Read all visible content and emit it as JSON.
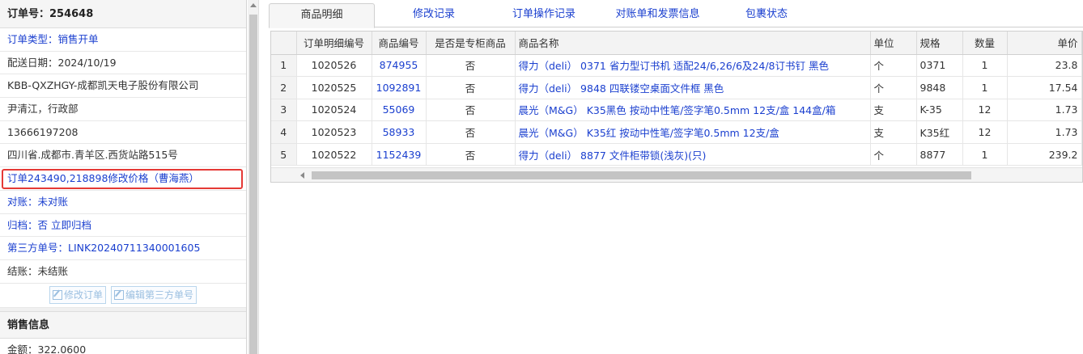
{
  "order": {
    "header": "订单号：254648",
    "rows": [
      {
        "label": "订单类型：",
        "value": "销售开单",
        "style": "blue"
      },
      {
        "label": "配送日期：",
        "value": "2024/10/19",
        "style": "plain"
      },
      {
        "label": "",
        "value": "KBB-QXZHGY-成都凯天电子股份有限公司",
        "style": "plain"
      },
      {
        "label": "",
        "value": "尹清江，行政部",
        "style": "plain"
      },
      {
        "label": "",
        "value": "13666197208",
        "style": "plain"
      },
      {
        "label": "",
        "value": "四川省.成都市.青羊区.西货站路515号",
        "style": "plain"
      },
      {
        "label": "",
        "value": "订单243490,218898修改价格（曹海燕）",
        "style": "highlight"
      },
      {
        "label": "对账：",
        "value": "未对账",
        "style": "blue"
      },
      {
        "label": "归档：",
        "value": "否 立即归档",
        "style": "blue"
      },
      {
        "label": "第三方单号：",
        "value": "LINK20240711340001605",
        "style": "blue"
      },
      {
        "label": "结账：",
        "value": "未结账",
        "style": "plainlabel"
      }
    ],
    "buttons": {
      "edit_order": "修改订单",
      "edit_third": "编辑第三方单号"
    }
  },
  "sales": {
    "header": "销售信息",
    "amount_label": "金额：",
    "amount_value": "322.0600"
  },
  "tabs": [
    "商品明细",
    "修改记录",
    "订单操作记录",
    "对账单和发票信息",
    "包裹状态"
  ],
  "active_tab": 0,
  "table": {
    "headers": [
      "订单明细编号",
      "商品编号",
      "是否是专柜商品",
      "商品名称",
      "单位",
      "规格",
      "数量",
      "单价"
    ],
    "rows": [
      [
        "1",
        "1020526",
        "874955",
        "否",
        "得力（deli） 0371 省力型订书机 适配24/6,26/6及24/8订书钉 黑色",
        "个",
        "0371",
        "1",
        "23.8"
      ],
      [
        "2",
        "1020525",
        "1092891",
        "否",
        "得力（deli） 9848 四联镂空桌面文件框 黑色",
        "个",
        "9848",
        "1",
        "17.54"
      ],
      [
        "3",
        "1020524",
        "55069",
        "否",
        "晨光（M&G） K35黑色 按动中性笔/签字笔0.5mm 12支/盒 144盒/箱",
        "支",
        "K-35",
        "12",
        "1.73"
      ],
      [
        "4",
        "1020523",
        "58933",
        "否",
        "晨光（M&G） K35红 按动中性笔/签字笔0.5mm 12支/盒",
        "支",
        "K35红",
        "12",
        "1.73"
      ],
      [
        "5",
        "1020522",
        "1152439",
        "否",
        "得力（deli） 8877 文件柜带锁(浅灰)(只)",
        "个",
        "8877",
        "1",
        "239.2"
      ]
    ]
  },
  "colors": {
    "link": "#1a3fcf",
    "highlight_border": "#e53935"
  }
}
